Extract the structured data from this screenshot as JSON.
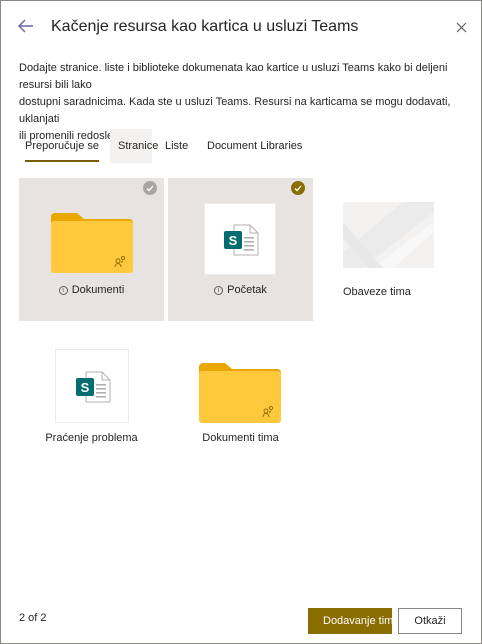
{
  "header": {
    "title": "Kačenje resursa kao kartica u usluzi Teams"
  },
  "description": {
    "line1": "Dodajte stranice. liste i biblioteke dokumenata kao kartice u usluzi Teams kako bi deljeni resursi bili lako",
    "line2": "dostupni saradnicima. Kada ste u usluzi Teams. Resursi na karticama se mogu dodavati, uklanjati",
    "line3": "ili promenili redosled."
  },
  "tabs": [
    {
      "label": "Preporučuje se",
      "selected": true
    },
    {
      "label": "Stranice",
      "selected": false
    },
    {
      "label": "Liste",
      "selected": false
    },
    {
      "label": "Document Libraries",
      "selected": false
    }
  ],
  "tiles": [
    {
      "label": "Dokumenti",
      "icon": "folder-icon",
      "selected": false,
      "info": true
    },
    {
      "label": "Početak",
      "icon": "sharepoint-page-icon",
      "selected": true,
      "info": true
    },
    {
      "label": "Obaveze tima",
      "icon": "image-thumbnail",
      "selected": false,
      "info": false
    },
    {
      "label": "Praćenje problema",
      "icon": "sharepoint-page-icon",
      "selected": false,
      "info": false
    },
    {
      "label": "Dokumenti tima",
      "icon": "folder-icon",
      "selected": false,
      "info": false
    }
  ],
  "footer": {
    "page_indicator": "2 of 2",
    "add_label": "Dodavanje tima",
    "cancel_label": "Otkaži"
  },
  "colors": {
    "accent": "#8a6d00",
    "folder": "#ffc83d",
    "sharepoint": "#036c70"
  }
}
